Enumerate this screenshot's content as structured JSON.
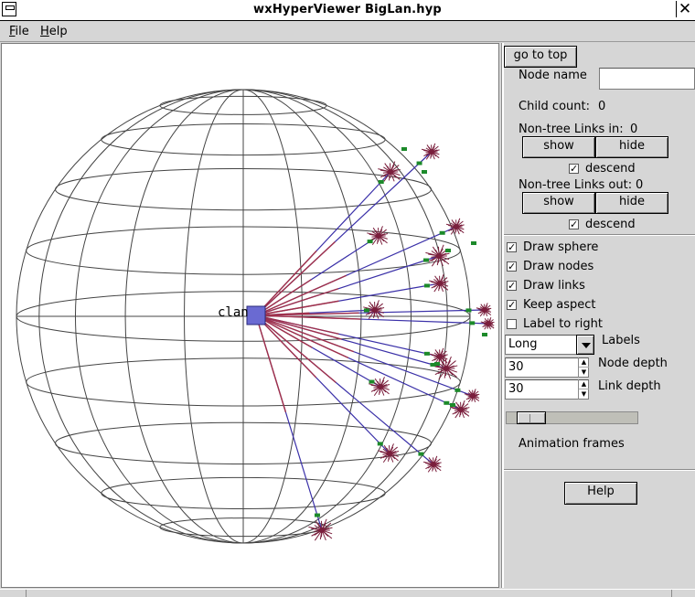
{
  "window": {
    "title": "wxHyperViewer BigLan.hyp"
  },
  "menu": {
    "file": "File",
    "help": "Help"
  },
  "graph": {
    "root_label": "clan",
    "colors": {
      "sphere": "#444444",
      "link_near": "#a0304a",
      "link_far": "#3a30a8",
      "node": "#7a1e3c",
      "marker": "#1c8a2a",
      "root": "#6a6ad2"
    }
  },
  "panel": {
    "go_to_top": "go to top",
    "node_name_label": "Node name",
    "node_name_value": "",
    "child_count_label": "Child count:",
    "child_count_value": "0",
    "links_in_label": "Non-tree Links in:",
    "links_in_value": "0",
    "show": "show",
    "hide": "hide",
    "descend": "descend",
    "links_out_label": "Non-tree Links out:",
    "links_out_value": "0",
    "draw_sphere": "Draw sphere",
    "draw_nodes": "Draw nodes",
    "draw_links": "Draw links",
    "keep_aspect": "Keep aspect",
    "label_to_right": "Label to right",
    "labels_value": "Long",
    "labels_label": "Labels",
    "node_depth_value": "30",
    "node_depth_label": "Node depth",
    "link_depth_value": "30",
    "link_depth_label": "Link depth",
    "animation_frames_label": "Animation frames",
    "help_button": "Help"
  }
}
